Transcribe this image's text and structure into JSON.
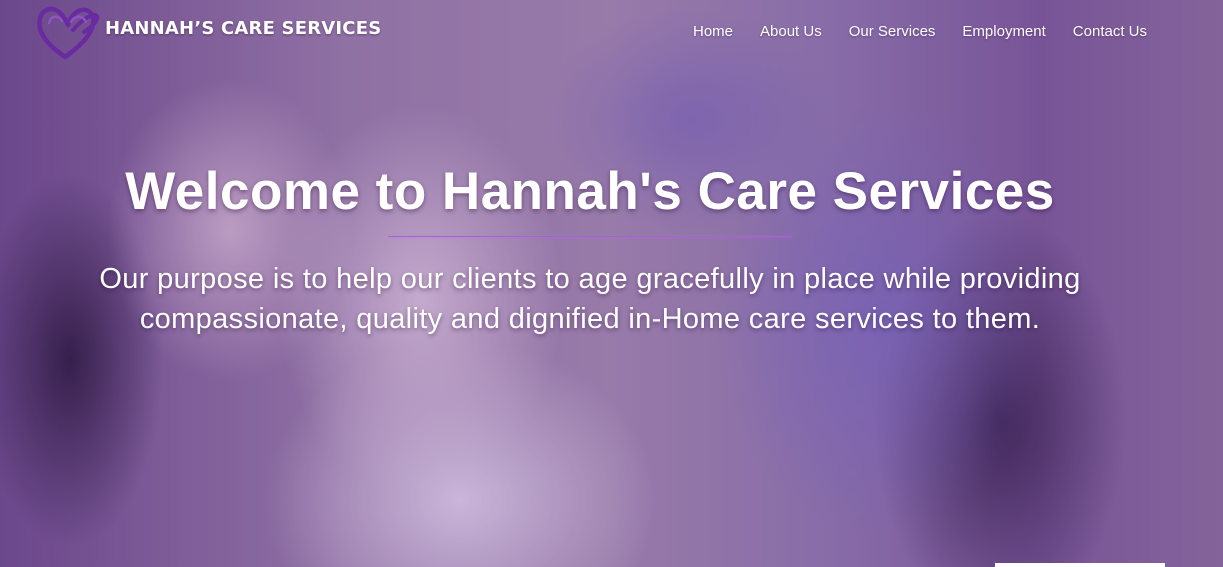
{
  "header": {
    "brand": "HANNAH’S CARE SERVICES",
    "logo_icon": "heart-hand-icon",
    "nav": [
      "Home",
      "About Us",
      "Our Services",
      "Employment",
      "Contact Us"
    ]
  },
  "hero": {
    "heading": "Welcome to Hannah's Care Services",
    "subtitle_lines": [
      "Our purpose is to help our clients to age gracefully in place while providing",
      "compassionate, quality and dignified in-Home care services to them."
    ]
  },
  "colors": {
    "logo_purple": "#6a2aa0",
    "divider_purple": "#a85fd8",
    "overlay_purple": "#6c3c96",
    "text_white": "#ffffff"
  }
}
